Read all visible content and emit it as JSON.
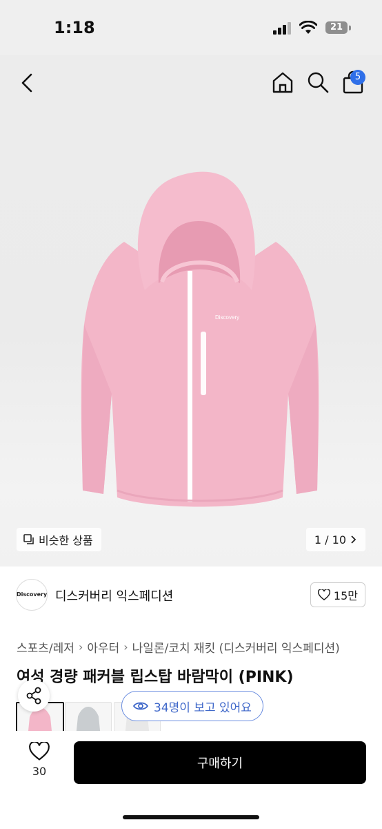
{
  "status": {
    "time": "1:18",
    "battery": "21"
  },
  "header": {
    "cart_count": "5"
  },
  "gallery": {
    "similar_label": "비슷한 상품",
    "counter": "1 / 10"
  },
  "shop": {
    "logo_text": "Discovery",
    "name": "디스커버리 익스페디션",
    "likes": "15만"
  },
  "breadcrumb": [
    "스포츠/레저",
    "아우터",
    "나일론/코치 재킷 (디스커버리 익스페디션)"
  ],
  "product": {
    "title": "여성 경량 패커블 립스탑 바람막이 (PINK)"
  },
  "viewers": {
    "label": "34명이 보고 있어요"
  },
  "bottom": {
    "wish_count": "30",
    "buy_label": "구매하기"
  },
  "colors": {
    "accent": "#2f6fe8",
    "jacket_pink": "#f2b3c6",
    "buy_button": "#000000"
  }
}
